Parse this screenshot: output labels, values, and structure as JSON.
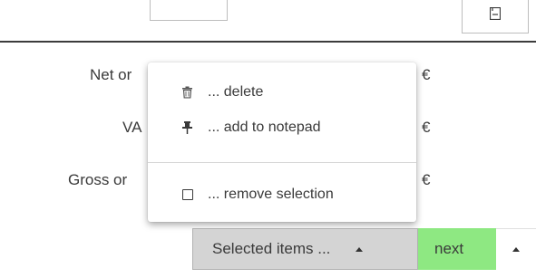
{
  "top_bar": {
    "save_icon": "save-icon"
  },
  "form": {
    "net_label": "Net or",
    "vat_label": "VA",
    "gross_label": "Gross or",
    "currency": "€"
  },
  "context_menu": {
    "items": [
      {
        "icon": "trash-icon",
        "label": "... delete"
      },
      {
        "icon": "pin-icon",
        "label": "... add to notepad"
      },
      {
        "icon": "checkbox-icon",
        "label": "... remove selection"
      }
    ]
  },
  "action_bar": {
    "selected_items_label": "Selected items ...",
    "next_label": "next",
    "colors": {
      "selected_bg": "#d4d4d4",
      "next_bg": "#8ee882"
    }
  }
}
